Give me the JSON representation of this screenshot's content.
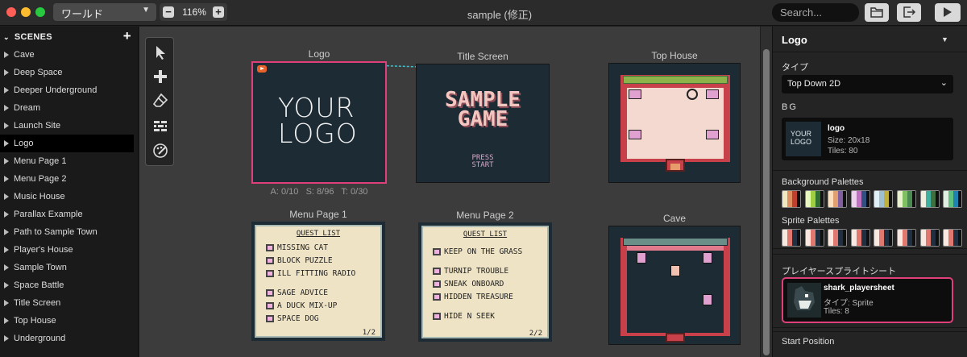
{
  "window": {
    "title": "sample (修正)"
  },
  "toolbar": {
    "world_select": "ワールド",
    "zoom_value": "116%",
    "zoom_out": "−",
    "zoom_in": "+",
    "search_placeholder": "Search..."
  },
  "sidebar": {
    "header": "SCENES",
    "add": "+",
    "items": [
      {
        "label": "Cave"
      },
      {
        "label": "Deep Space"
      },
      {
        "label": "Deeper Underground"
      },
      {
        "label": "Dream"
      },
      {
        "label": "Launch Site"
      },
      {
        "label": "Logo",
        "active": true
      },
      {
        "label": "Menu Page 1"
      },
      {
        "label": "Menu Page 2"
      },
      {
        "label": "Music House"
      },
      {
        "label": "Parallax Example"
      },
      {
        "label": "Path to Sample Town"
      },
      {
        "label": "Player's House"
      },
      {
        "label": "Sample Town"
      },
      {
        "label": "Space Battle"
      },
      {
        "label": "Title Screen"
      },
      {
        "label": "Top House"
      },
      {
        "label": "Underground"
      }
    ]
  },
  "canvas": {
    "scenes": {
      "logo": {
        "title": "Logo",
        "text_line1": "YOUR",
        "text_line2": "LOGO",
        "stats": "A: 0/10   S: 8/96   T: 0/30"
      },
      "title_screen": {
        "title": "Title Screen",
        "line1": "SAMPLE",
        "line2": "GAME",
        "press1": "PRESS",
        "press2": "START"
      },
      "top_house": {
        "title": "Top House"
      },
      "menu1": {
        "title": "Menu Page 1",
        "heading": "QUEST LIST",
        "items": [
          "MISSING CAT",
          "BLOCK PUZZLE",
          "ILL FITTING RADIO",
          "SAGE ADVICE",
          "A DUCK MIX-UP",
          "SPACE DOG"
        ],
        "page": "1/2"
      },
      "menu2": {
        "title": "Menu Page 2",
        "heading": "QUEST LIST",
        "items": [
          "KEEP ON THE GRASS",
          "TURNIP TROUBLE",
          "SNEAK ONBOARD",
          "HIDDEN TREASURE",
          "HIDE N SEEK"
        ],
        "page": "2/2"
      },
      "cave": {
        "title": "Cave"
      }
    }
  },
  "inspector": {
    "title": "Logo",
    "type_label": "タイプ",
    "type_value": "Top Down 2D",
    "bg_label": "BG",
    "bg": {
      "thumb_line1": "YOUR",
      "thumb_line2": "LOGO",
      "name": "logo",
      "size": "Size:  20x18",
      "tiles": "Tiles:  80"
    },
    "bg_palettes_label": "Background Palettes",
    "sprite_palettes_label": "Sprite Palettes",
    "player_sheet_label": "プレイヤースプライトシート",
    "player_sheet": {
      "name": "shark_playersheet",
      "type": "タイプ:  Sprite",
      "tiles": "Tiles:  8"
    },
    "start_position_label": "Start Position"
  },
  "colors": {
    "accent": "#e0407a",
    "gb_dark": "#1c2b34",
    "gb_light": "#efe3c5",
    "connection": "#3dbfcf",
    "bg_palettes": [
      [
        "#f0e8c0",
        "#e09060",
        "#c04030",
        "#101010"
      ],
      [
        "#e8f8c0",
        "#a0d040",
        "#307030",
        "#101010"
      ],
      [
        "#f8e0c0",
        "#e0a070",
        "#8060a0",
        "#101010"
      ],
      [
        "#f0d0f0",
        "#c070c0",
        "#305080",
        "#101010"
      ],
      [
        "#e0f0f8",
        "#a0c0d0",
        "#c0b040",
        "#101010"
      ],
      [
        "#e8f0d0",
        "#80c060",
        "#4a8a50",
        "#101010"
      ],
      [
        "#f0f0e0",
        "#40b0a0",
        "#407040",
        "#101010"
      ],
      [
        "#e0f0e0",
        "#60c080",
        "#2080b0",
        "#101010"
      ]
    ],
    "sprite_palette": [
      "#f8e8e0",
      "#e07870",
      "#203040",
      "#101010"
    ]
  }
}
